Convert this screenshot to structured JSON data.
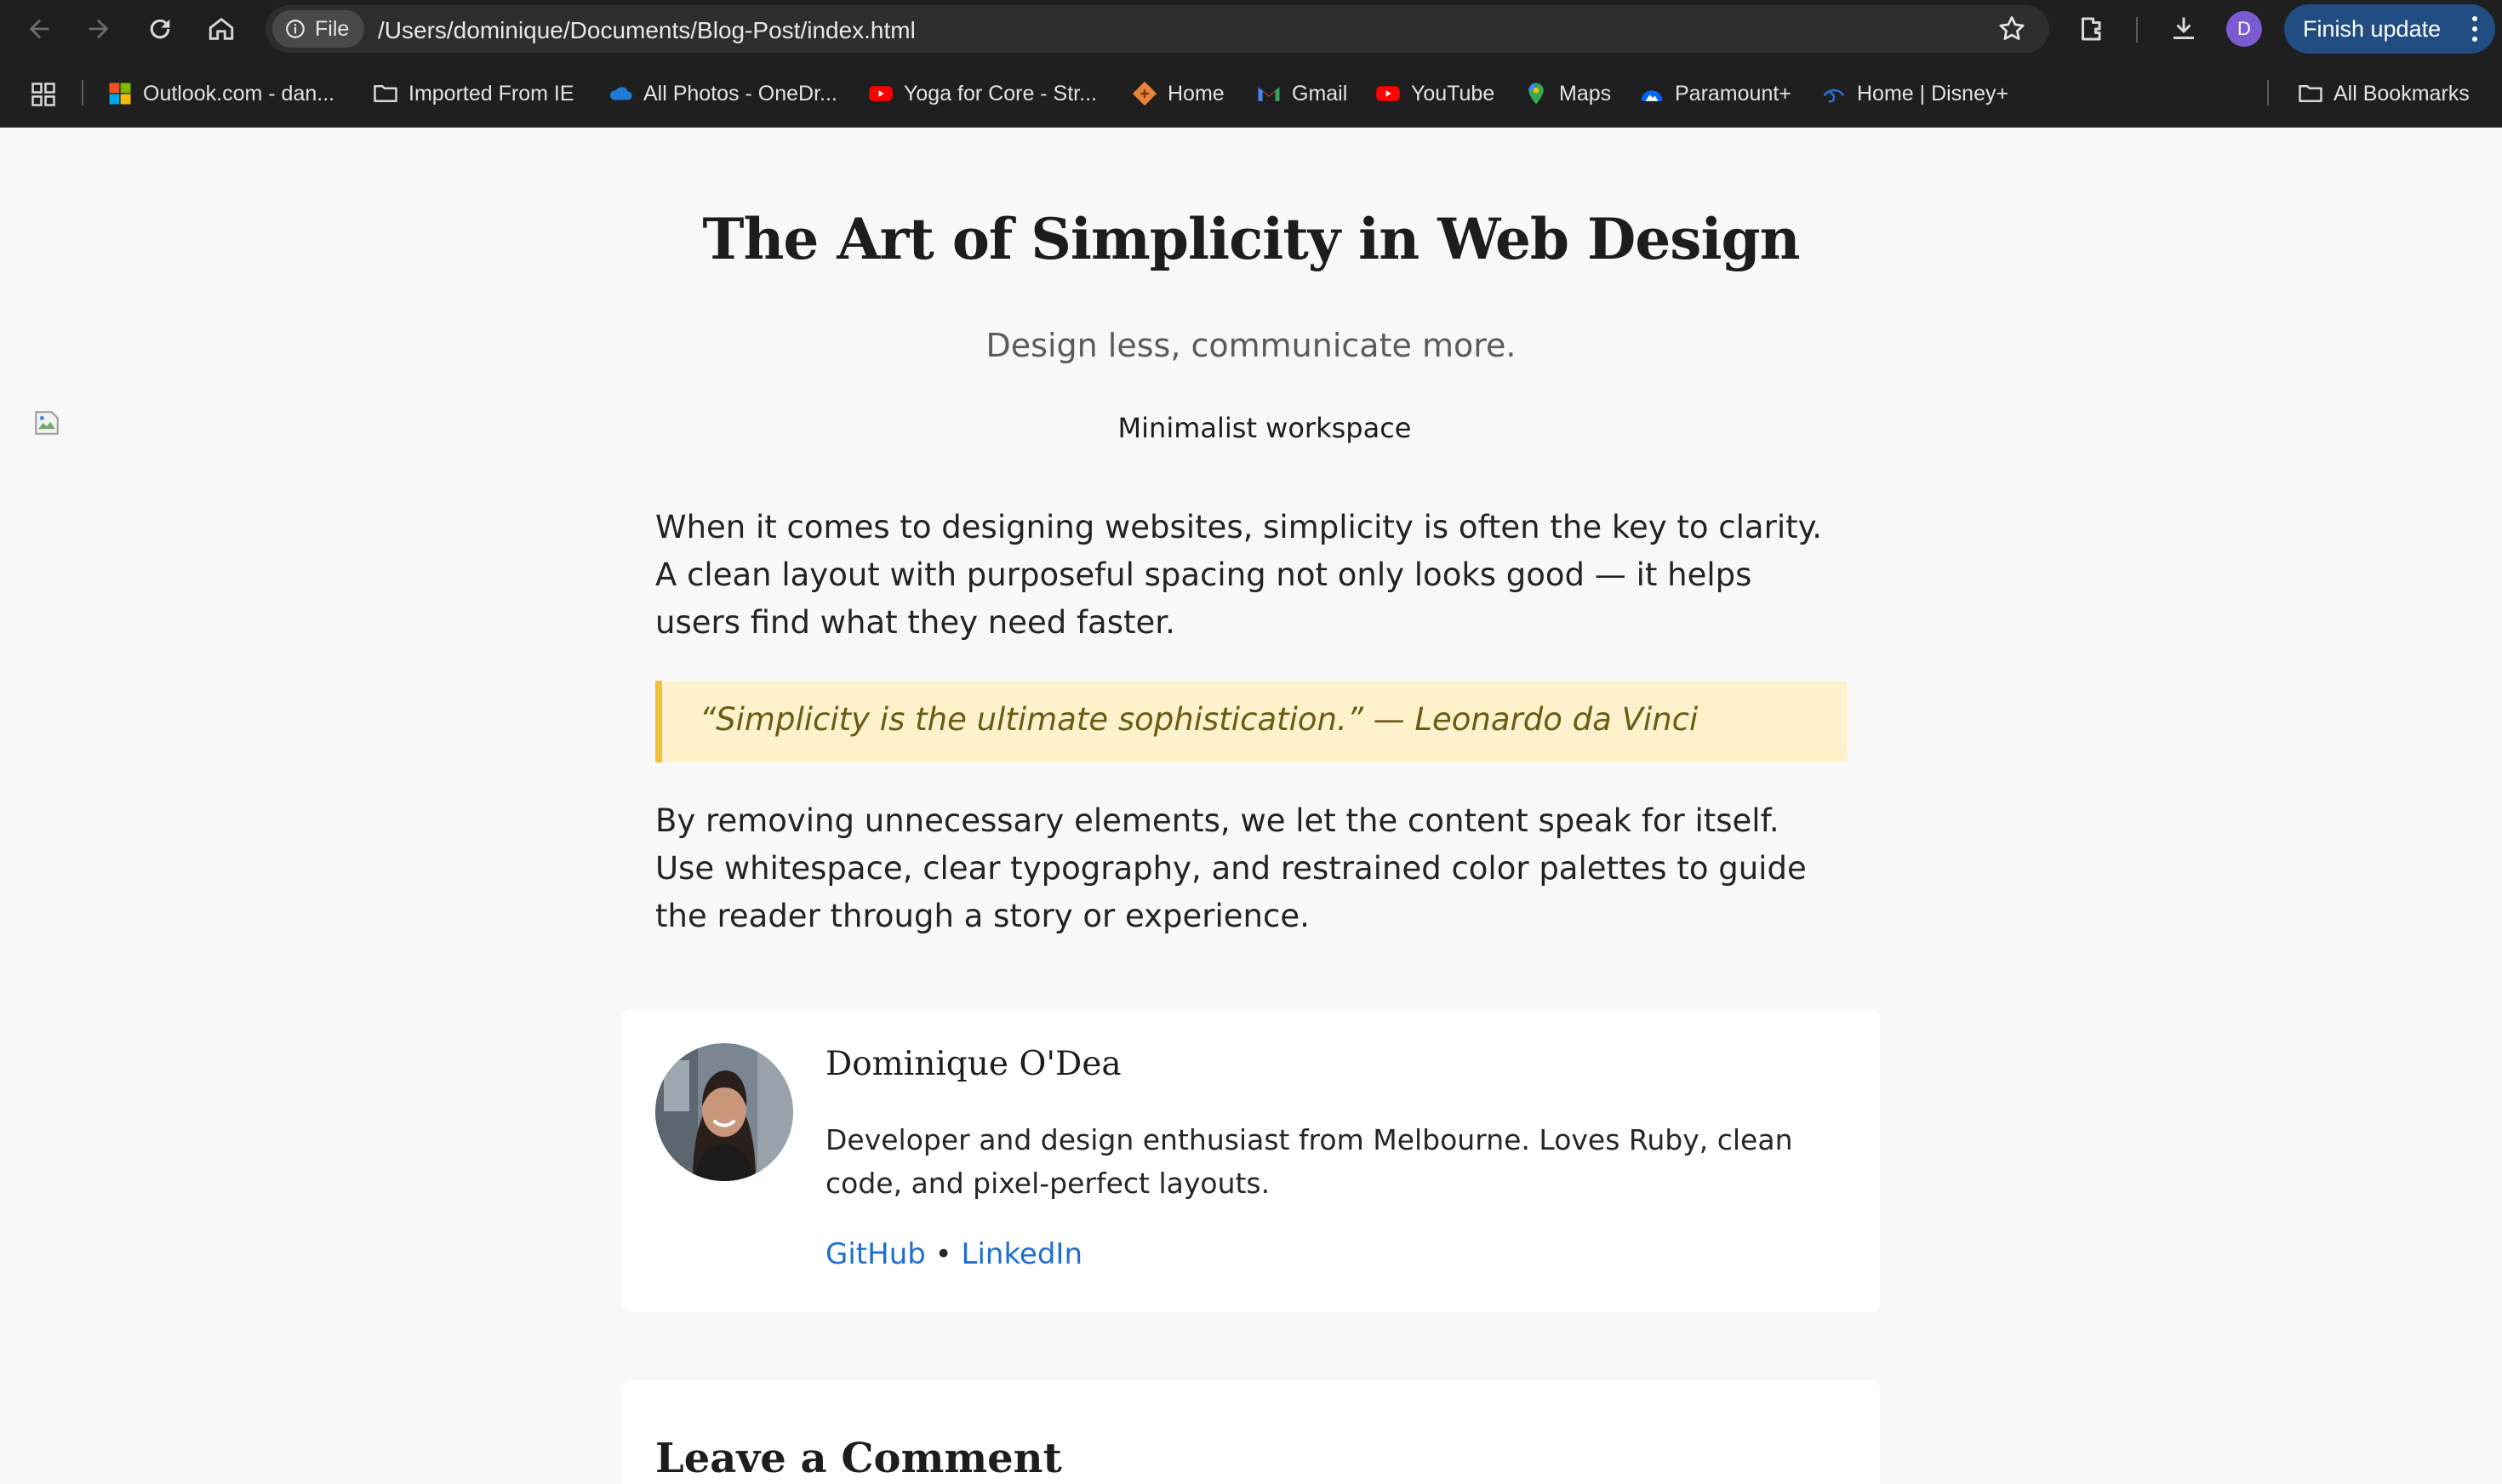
{
  "browser": {
    "file_chip_label": "File",
    "url": "/Users/dominique/Documents/Blog-Post/index.html",
    "profile_initial": "D",
    "finish_update_label": "Finish update",
    "icons": [
      "back-arrow-icon",
      "forward-arrow-icon",
      "reload-icon",
      "home-icon",
      "info-icon",
      "star-icon",
      "extensions-icon",
      "download-icon",
      "more-vert-icon",
      "apps-grid-icon"
    ],
    "bookmarks": [
      {
        "label": "Outlook.com - dan...",
        "icon": "microsoft-icon"
      },
      {
        "label": "Imported From IE",
        "icon": "folder-icon"
      },
      {
        "label": "All Photos - OneDr...",
        "icon": "onedrive-cloud-icon"
      },
      {
        "label": "Yoga for Core - Str...",
        "icon": "youtube-icon"
      },
      {
        "label": "Home",
        "icon": "home-favicon-icon"
      },
      {
        "label": "Gmail",
        "icon": "gmail-icon"
      },
      {
        "label": "YouTube",
        "icon": "youtube-icon"
      },
      {
        "label": "Maps",
        "icon": "maps-pin-icon"
      },
      {
        "label": "Paramount+",
        "icon": "paramount-icon"
      },
      {
        "label": "Home | Disney+",
        "icon": "disney-icon"
      }
    ],
    "all_bookmarks_label": "All Bookmarks"
  },
  "article": {
    "title": "The Art of Simplicity in Web Design",
    "subtitle": "Design less, communicate more.",
    "image_alt": "Minimalist workspace",
    "paragraph1": "When it comes to designing websites, simplicity is often the key to clarity. A clean layout with purposeful spacing not only looks good — it helps users find what they need faster.",
    "quote": "“Simplicity is the ultimate sophistication.” — Leonardo da Vinci",
    "paragraph2": "By removing unnecessary elements, we let the content speak for itself. Use whitespace, clear typography, and restrained color palettes to guide the reader through a story or experience."
  },
  "author": {
    "name": "Dominique O'Dea",
    "bio": "Developer and design enthusiast from Melbourne. Loves Ruby, clean code, and pixel-perfect layouts.",
    "github_label": "GitHub",
    "separator": "•",
    "linkedin_label": "LinkedIn"
  },
  "comments": {
    "heading": "Leave a Comment"
  },
  "colors": {
    "chrome_bg": "#1f1f1f",
    "page_bg": "#f8f8f8",
    "quote_bg": "#fdf2cc",
    "quote_border": "#f2c23c",
    "link": "#1f6fd0",
    "finish_btn": "#224d82"
  }
}
